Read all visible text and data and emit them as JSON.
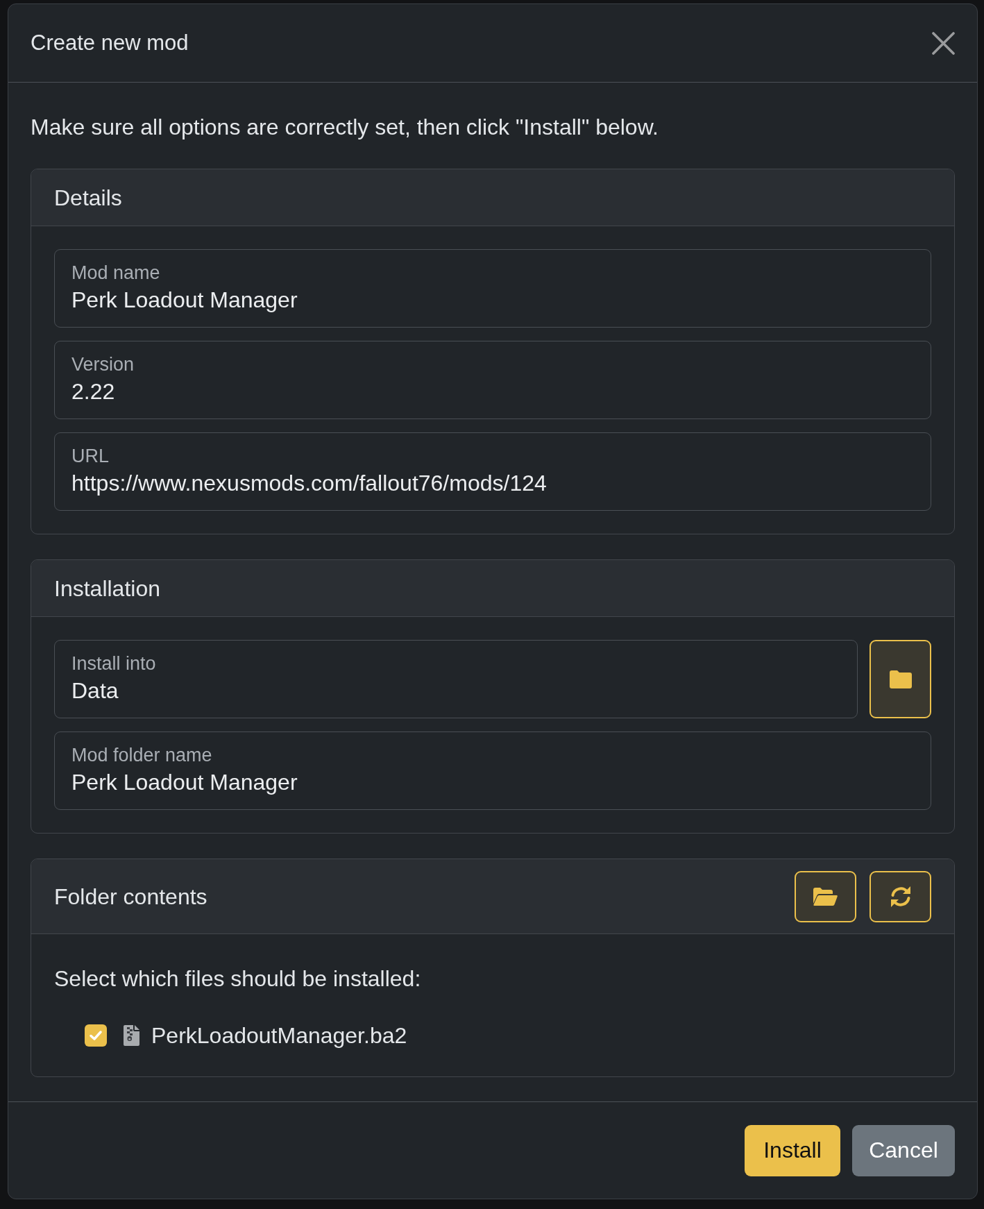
{
  "dialog": {
    "title": "Create new mod"
  },
  "intro": "Make sure all options are correctly set, then click \"Install\" below.",
  "details": {
    "title": "Details",
    "fields": [
      {
        "label": "Mod name",
        "value": "Perk Loadout Manager"
      },
      {
        "label": "Version",
        "value": "2.22"
      },
      {
        "label": "URL",
        "value": "https://www.nexusmods.com/fallout76/mods/124"
      }
    ]
  },
  "installation": {
    "title": "Installation",
    "fields": [
      {
        "kind": "folder",
        "label": "Install into",
        "value": "Data"
      },
      {
        "kind": "text",
        "label": "Mod folder name",
        "value": "Perk Loadout Manager"
      }
    ]
  },
  "folder_contents": {
    "title": "Folder contents",
    "prompt": "Select which files should be installed:",
    "files": [
      {
        "name": "PerkLoadoutManager.ba2",
        "checked": true
      }
    ]
  },
  "footer": {
    "buttons": [
      {
        "label": "Install",
        "kind": "primary"
      },
      {
        "label": "Cancel",
        "kind": "secondary"
      }
    ]
  }
}
